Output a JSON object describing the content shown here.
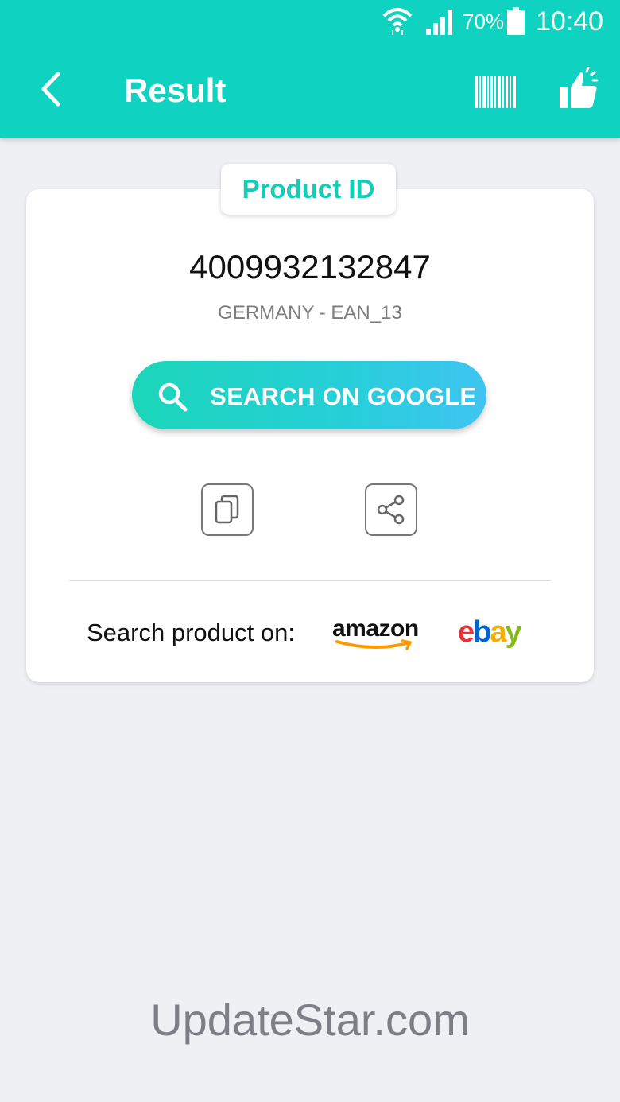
{
  "status_bar": {
    "battery_percent": "70%",
    "time": "10:40"
  },
  "app_bar": {
    "title": "Result",
    "icons": [
      "back-arrow-icon",
      "barcode-icon",
      "thumbs-up-icon"
    ]
  },
  "result": {
    "tab_label": "Product ID",
    "code": "4009932132847",
    "code_type": "GERMANY - EAN_13",
    "google_button_label": "SEARCH ON GOOGLE",
    "search_on_label": "Search product on:",
    "amazon_label": "amazon",
    "ebay_letters": [
      "e",
      "b",
      "a",
      "y"
    ]
  },
  "colors": {
    "accent": "#0fd3c0",
    "ebay_e": "#e53238",
    "ebay_b": "#0064d2",
    "ebay_a": "#f5af02",
    "ebay_y": "#86b817",
    "amazon_smile": "#ff9900"
  },
  "watermark": "UpdateStar.com"
}
